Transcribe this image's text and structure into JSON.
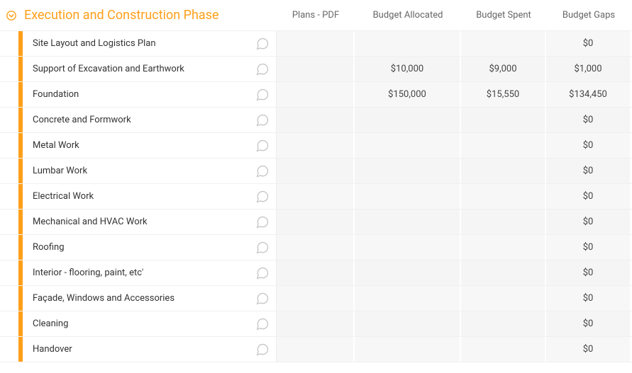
{
  "section": {
    "title": "Execution and Construction Phase"
  },
  "columns": {
    "plans": "Plans - PDF",
    "allocated": "Budget Allocated",
    "spent": "Budget Spent",
    "gaps": "Budget Gaps"
  },
  "rows": [
    {
      "name": "Site Layout and Logistics Plan",
      "plans": "",
      "allocated": "",
      "spent": "",
      "gaps": "$0"
    },
    {
      "name": "Support of Excavation and Earthwork",
      "plans": "",
      "allocated": "$10,000",
      "spent": "$9,000",
      "gaps": "$1,000"
    },
    {
      "name": "Foundation",
      "plans": "",
      "allocated": "$150,000",
      "spent": "$15,550",
      "gaps": "$134,450"
    },
    {
      "name": "Concrete and Formwork",
      "plans": "",
      "allocated": "",
      "spent": "",
      "gaps": "$0"
    },
    {
      "name": "Metal Work",
      "plans": "",
      "allocated": "",
      "spent": "",
      "gaps": "$0"
    },
    {
      "name": "Lumbar Work",
      "plans": "",
      "allocated": "",
      "spent": "",
      "gaps": "$0"
    },
    {
      "name": "Electrical Work",
      "plans": "",
      "allocated": "",
      "spent": "",
      "gaps": "$0"
    },
    {
      "name": "Mechanical and HVAC Work",
      "plans": "",
      "allocated": "",
      "spent": "",
      "gaps": "$0"
    },
    {
      "name": "Roofing",
      "plans": "",
      "allocated": "",
      "spent": "",
      "gaps": "$0"
    },
    {
      "name": "Interior - flooring, paint, etc'",
      "plans": "",
      "allocated": "",
      "spent": "",
      "gaps": "$0"
    },
    {
      "name": "Façade, Windows and Accessories",
      "plans": "",
      "allocated": "",
      "spent": "",
      "gaps": "$0"
    },
    {
      "name": "Cleaning",
      "plans": "",
      "allocated": "",
      "spent": "",
      "gaps": "$0"
    },
    {
      "name": "Handover",
      "plans": "",
      "allocated": "",
      "spent": "",
      "gaps": "$0"
    }
  ]
}
